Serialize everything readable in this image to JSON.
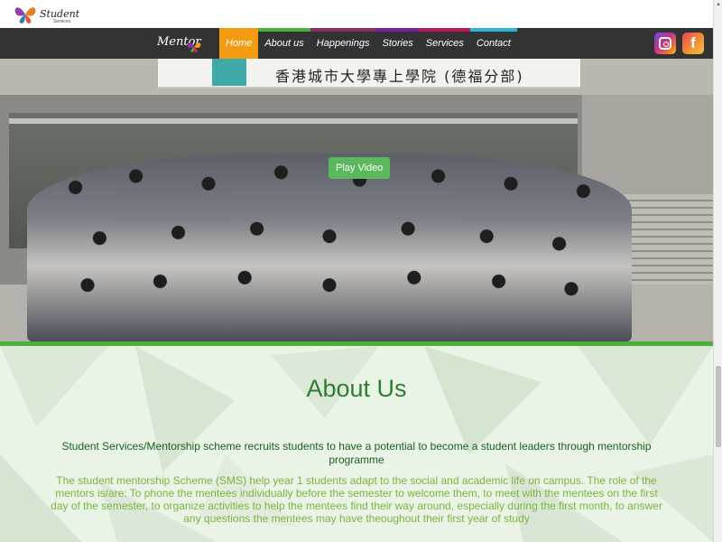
{
  "site": {
    "top_logo_text": "Student",
    "top_logo_sub": "Services",
    "nav_logo_text": "Mentor"
  },
  "nav": {
    "items": [
      {
        "label": "Home",
        "active": true,
        "strip": "#f39c12"
      },
      {
        "label": "About us",
        "active": false,
        "strip": "#4caf3a"
      },
      {
        "label": "Happenings",
        "active": false,
        "strip": "#8e2b63"
      },
      {
        "label": "Stories",
        "active": false,
        "strip": "#7b1fa2"
      },
      {
        "label": "Services",
        "active": false,
        "strip": "#c2185b"
      },
      {
        "label": "Contact",
        "active": false,
        "strip": "#29b6d8"
      }
    ],
    "social": [
      {
        "icon": "instagram-icon"
      },
      {
        "icon": "facebook-icon",
        "glyph": "f"
      }
    ]
  },
  "hero": {
    "sign_text": "香港城市大學專上學院 (德福分部)",
    "play_label": "Play Video"
  },
  "about": {
    "title": "About Us",
    "subtitle": "Student Services/Mentorship scheme recruits students to have a potential to become a student leaders through mentorship programme",
    "body": "The student mentorship Scheme (SMS) help year 1 students adapt to the social and academic life on campus. The role of the mentors is/are: To phone the mentees individually before the semester to welcome them, to meet with the mentees on the first day of the semester, to organize activities to help the mentees find their way around, especially during the first month, to answer any questions the mentees may have theoughout their first year of study"
  },
  "colors": {
    "nav_bg": "#333333",
    "accent_green": "#4caf3a",
    "title_green": "#2e7d32",
    "body_green": "#7cb342",
    "active_orange": "#f39c12"
  }
}
